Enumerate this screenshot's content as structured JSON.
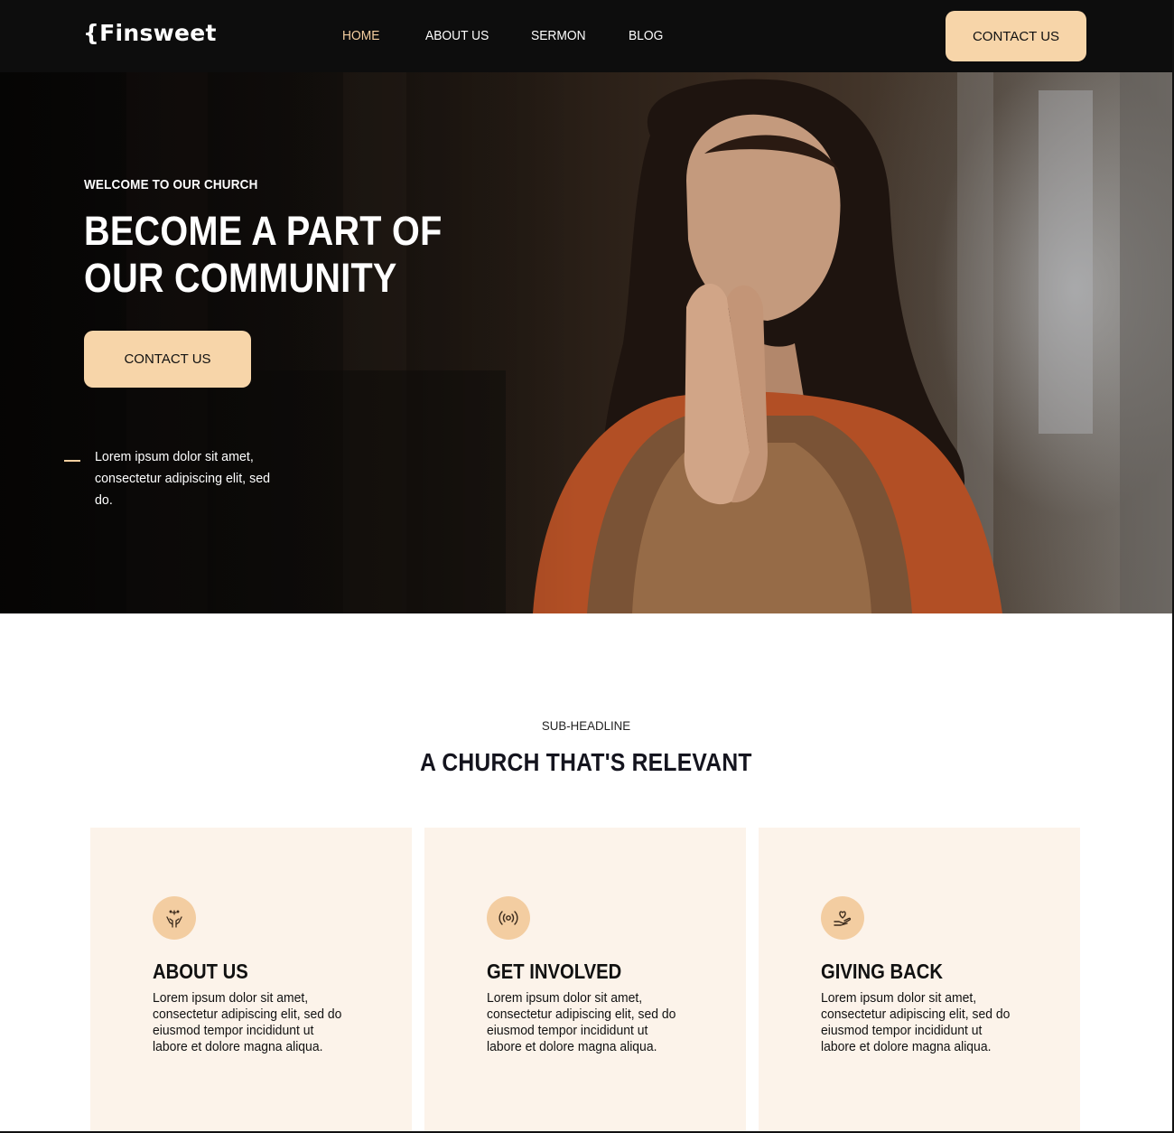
{
  "brand": {
    "logo": "{Finsweet"
  },
  "nav": {
    "links": [
      {
        "label": "HOME",
        "active": true
      },
      {
        "label": "ABOUT US"
      },
      {
        "label": "SERMON"
      },
      {
        "label": "BLOG"
      }
    ],
    "cta": "CONTACT US"
  },
  "hero": {
    "eyebrow": "WELCOME TO OUR CHURCH",
    "title": "BECOME A PART OF OUR COMMUNITY",
    "cta": "CONTACT US",
    "text": "Lorem ipsum dolor sit amet, consectetur adipiscing elit, sed do."
  },
  "section": {
    "sub_headline": "SUB-HEADLINE",
    "title": "A CHURCH THAT'S RELEVANT",
    "cards": [
      {
        "icon": "praying-hands-icon",
        "title": "ABOUT US",
        "text": "Lorem ipsum dolor sit amet, consectetur adipiscing elit, sed do eiusmod tempor incididunt ut labore et dolore magna aliqua."
      },
      {
        "icon": "broadcast-icon",
        "title": "GET INVOLVED",
        "text": "Lorem ipsum dolor sit amet, consectetur adipiscing elit, sed do eiusmod tempor incididunt ut labore et dolore magna aliqua."
      },
      {
        "icon": "heart-hand-icon",
        "title": "GIVING BACK",
        "text": "Lorem ipsum dolor sit amet, consectetur adipiscing elit, sed do eiusmod tempor incididunt ut labore et dolore magna aliqua."
      }
    ]
  },
  "colors": {
    "nav_bg": "#0d0d0d",
    "accent": "#f7d5a9",
    "active_link": "#f5cfa0",
    "card_bg": "#fcf3ea",
    "icon_bg": "#f3cda1"
  }
}
